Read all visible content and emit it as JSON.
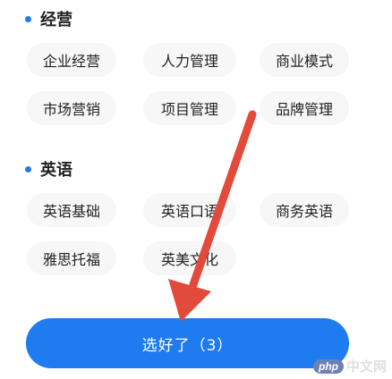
{
  "sections": [
    {
      "title": "经营",
      "items": [
        "企业经营",
        "人力管理",
        "商业模式",
        "市场营销",
        "项目管理",
        "品牌管理"
      ]
    },
    {
      "title": "英语",
      "items": [
        "英语基础",
        "英语口语",
        "商务英语",
        "雅思托福",
        "英美文化"
      ]
    }
  ],
  "confirm_button": {
    "label": "选好了（3）"
  },
  "watermark": {
    "logo": "php",
    "text": "中文网"
  },
  "colors": {
    "accent": "#1e7bf0",
    "tag_bg": "#f7f7f8",
    "arrow": "#e24a3b"
  }
}
